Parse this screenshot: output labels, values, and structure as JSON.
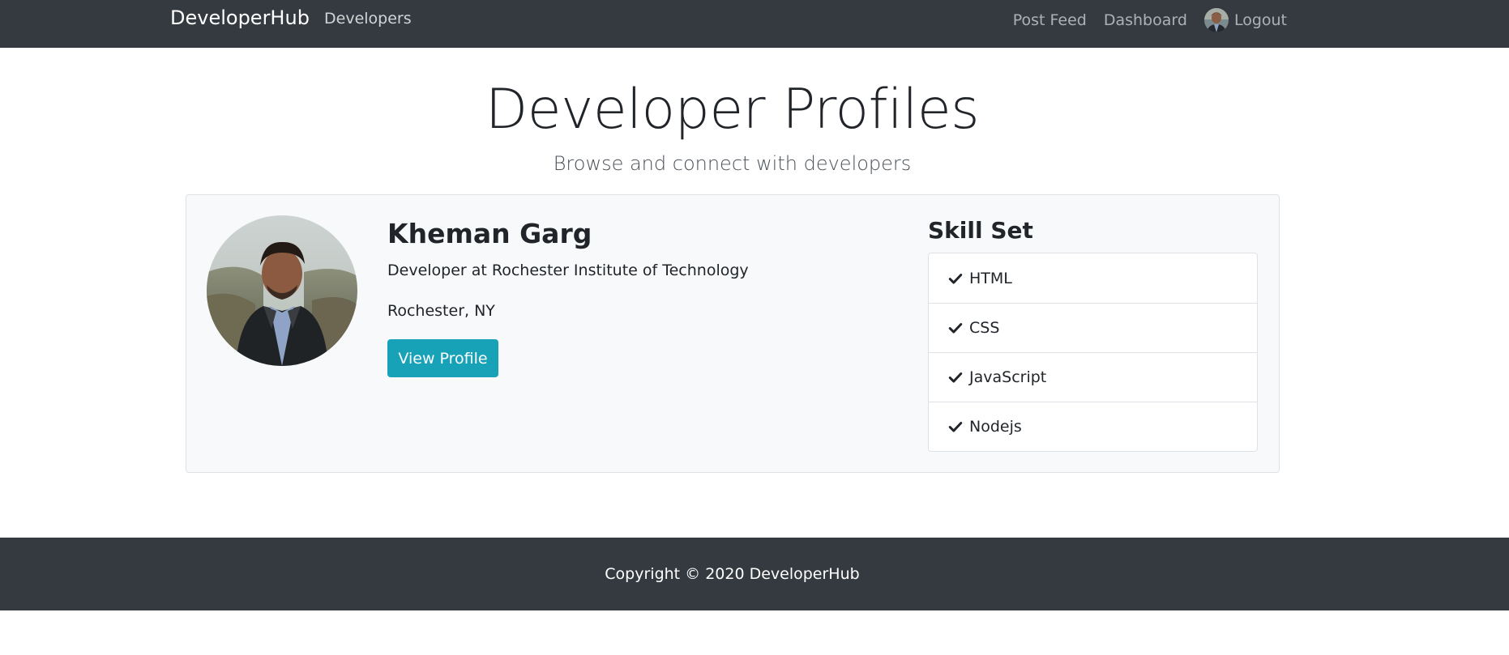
{
  "navbar": {
    "brand": "DeveloperHub",
    "left_link": "Developers",
    "right_links": {
      "post_feed": "Post Feed",
      "dashboard": "Dashboard",
      "logout": "Logout"
    }
  },
  "header": {
    "title": "Developer Profiles",
    "subtitle": "Browse and connect with developers"
  },
  "profile": {
    "name": "Kheman Garg",
    "position": "Developer at Rochester Institute of Technology",
    "location": "Rochester, NY",
    "view_button": "View Profile",
    "skill_title": "Skill Set",
    "skills": [
      "HTML",
      "CSS",
      "JavaScript",
      "Nodejs"
    ]
  },
  "footer": {
    "text": "Copyright © 2020 DeveloperHub"
  },
  "colors": {
    "navbar": "#343a40",
    "button": "#17a2b8",
    "card_bg": "#f8f9fa"
  },
  "icons": {
    "skill": "check-icon",
    "avatar": "user-photo"
  }
}
